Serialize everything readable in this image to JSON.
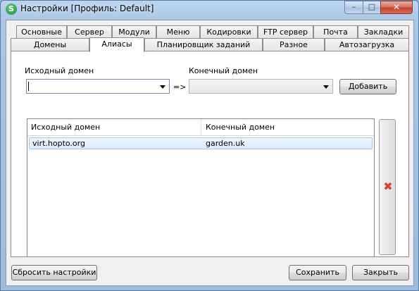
{
  "window": {
    "title": "Настройки [Профиль: Default]",
    "app_icon_letter": "S",
    "minimize_glyph": "–",
    "maximize_glyph": "□",
    "close_glyph": "✕"
  },
  "tabs_row1": [
    "Основные",
    "Сервер",
    "Модули",
    "Меню",
    "Кодировки",
    "FTP сервер",
    "Почта",
    "Закладки"
  ],
  "tabs_row2": [
    "Домены",
    "Алиасы",
    "Планировщик заданий",
    "Разное",
    "Автозагрузка"
  ],
  "active_tab": "Алиасы",
  "form": {
    "source_label": "Исходный домен",
    "target_label": "Конечный домен",
    "source_value": "",
    "target_value": "",
    "arrow_text": "=>",
    "add_button": "Добавить"
  },
  "list": {
    "columns": [
      "Исходный домен",
      "Конечный домен"
    ],
    "rows": [
      {
        "source": "virt.hopto.org",
        "target": "garden.uk"
      }
    ]
  },
  "side": {
    "delete_icon": "delete-icon",
    "delete_glyph": "✖",
    "delete_color": "#d9412b"
  },
  "footer": {
    "reset_button": "Сбросить настройки",
    "save_button": "Сохранить",
    "close_button": "Закрыть"
  }
}
